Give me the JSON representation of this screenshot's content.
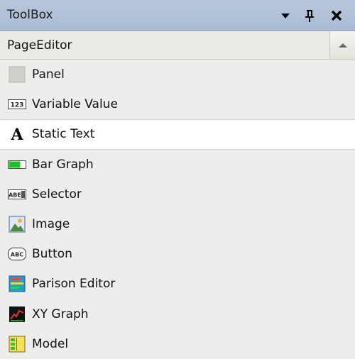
{
  "window": {
    "title": "ToolBox",
    "category": "PageEditor"
  },
  "items": [
    {
      "label": "Panel",
      "icon": "panel-icon"
    },
    {
      "label": "Variable Value",
      "icon": "variable-value-icon",
      "icon_text": "123"
    },
    {
      "label": "Static Text",
      "icon": "static-text-icon",
      "icon_text": "A",
      "selected": true
    },
    {
      "label": "Bar Graph",
      "icon": "bar-graph-icon"
    },
    {
      "label": "Selector",
      "icon": "selector-icon",
      "icon_text": "ABE"
    },
    {
      "label": "Image",
      "icon": "image-icon"
    },
    {
      "label": "Button",
      "icon": "button-icon",
      "icon_text": "ABC"
    },
    {
      "label": "Parison Editor",
      "icon": "parison-editor-icon"
    },
    {
      "label": "XY Graph",
      "icon": "xy-graph-icon"
    },
    {
      "label": "Model",
      "icon": "model-icon"
    }
  ],
  "colors": {
    "titlebar": "#b0c2d8",
    "background": "#ededeb",
    "selected_row": "#ffffff"
  }
}
